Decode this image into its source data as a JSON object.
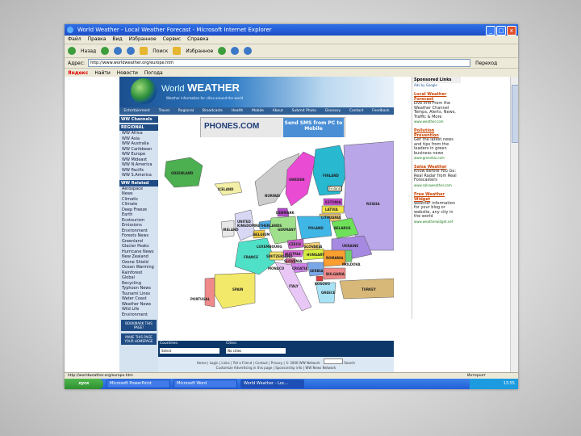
{
  "window": {
    "title": "World Weather - Local Weather Forecast - Microsoft Internet Explorer",
    "controls": [
      "_",
      "□",
      "x"
    ]
  },
  "menu": [
    "Файл",
    "Правка",
    "Вид",
    "Избранное",
    "Сервис",
    "Справка"
  ],
  "toolbar": {
    "back": "Назад",
    "search": "Поиск",
    "favorites": "Избранное"
  },
  "address": {
    "label": "Адрес:",
    "url": "http://www.worldweather.org/europe.htm",
    "go": "Переход"
  },
  "yandex": {
    "logo": "Яндекс",
    "find": "Найти",
    "news": "Новости",
    "weather": "Погода"
  },
  "site": {
    "brand_prefix": "World",
    "brand_main": "WEATHER",
    "slogan": "Weather information for cities around the world",
    "nav": [
      "Entertainment",
      "Travel",
      "Regional",
      "Broadcasts",
      "Health",
      "Mobile",
      "About",
      "Submit Photo",
      "Glossary",
      "Contact",
      "Feedback"
    ],
    "sidebar": {
      "channels": "WW Channels",
      "regional_head": "REGIONAL",
      "regional": [
        "WW Africa",
        "WW Asia",
        "WW Australia",
        "WW Caribbean",
        "WW Europe",
        "WW Mideast",
        "WW N.America",
        "WW Pacific",
        "WW S.America"
      ],
      "related_head": "WW Related",
      "related": [
        "Aerospace",
        "News",
        "Climatic",
        "Climate",
        "Deep Freeze",
        "Earth",
        "Ecotourism",
        "Emissions",
        "Environment",
        "Forests News",
        "Greenland",
        "Glacier Peaks",
        "Hurricane News",
        "New Zealand",
        "Ozone Shield",
        "Ocean Warming",
        "Rainforest",
        "Global",
        "Recycling",
        "Typhoon News",
        "Tsunami Lines",
        "Water Coast",
        "Weather News",
        "Wild Life",
        "Environment"
      ],
      "bookmark": "BOOKMARK THIS PAGE!",
      "homepage": "MAKE THIS PAGE YOUR HOMEPAGE"
    },
    "ad": {
      "phones": "PHONES.COM",
      "sms": "Send SMS from PC to Mobile"
    },
    "map_labels": {
      "greenland": "GREENLAND",
      "iceland": "ICELAND",
      "sweden": "SWEDEN",
      "finland": "FINLAND",
      "norway": "NORWAY",
      "russia": "RUSSIA",
      "estonia": "ESTONIA",
      "latvia": "LATVIA",
      "lithuania": "LITHUANIA",
      "denmark": "DENMARK",
      "uk": "UNITED KINGDOM",
      "ireland": "IRELAND",
      "netherlands": "NETHERLANDS",
      "belgium": "BELGIUM",
      "germany": "GERMANY",
      "poland": "POLAND",
      "belarus": "BELARUS",
      "ukraine": "UKRAINE",
      "france": "FRANCE",
      "luxembourg": "LUXEMBOURG",
      "czech": "CZECH",
      "slovakia": "SLOVAKIA",
      "austria": "AUSTRIA",
      "switzerland": "SWITZERLAND",
      "hungary": "HUNGARY",
      "romania": "ROMANIA",
      "moldova": "MOLDOVA",
      "italy": "ITALY",
      "spain": "SPAIN",
      "portugal": "PORTUGAL",
      "bulgaria": "BULGARIA",
      "greece": "GREECE",
      "slovenia": "SLOVENIA",
      "croatia": "CROATIA",
      "monaco": "MONACO",
      "turkey": "TURKEY",
      "kosovo": "KOSOVO",
      "serbia": "SERBIA",
      "tooltip": "Finland"
    },
    "countries_label": "Countries:",
    "countries_value": "Select",
    "cities_label": "Cities:",
    "cities_value": "No cities",
    "footer_line1": "Home | Login | Links | Tell a Friend | Contact | Privacy | © 2006 WW Network",
    "footer_search": "Search",
    "footer_line2": "Customize Advertising in this page | Sponsorship info | WW News Network"
  },
  "sponsored": {
    "title": "Sponsored Links",
    "google": "Ads by Google",
    "links": [
      {
        "title": "Local Weather Forecast",
        "desc": "Live Info From the Weather Channel Temps, Alerts, News, Traffic & More",
        "url": "www.weather.com"
      },
      {
        "title": "Pollution Prevention",
        "desc": "Get the latest news and tips from the leaders in green business news",
        "url": "www.greenbiz.com"
      },
      {
        "title": "Salsa Weather",
        "desc": "Know Before You Go: Real Radar from Real Forecasters",
        "url": "www.salsaweather.com"
      },
      {
        "title": "Free Weather Widget",
        "desc": "weather information for your blog or website, any city in the world",
        "url": "www.weatherwidget.net"
      }
    ]
  },
  "status": {
    "text": "http://worldweather.org/europe.htm",
    "zone": "Интернет"
  },
  "taskbar": {
    "start": "пуск",
    "tasks": [
      "Microsoft PowerPoint",
      "Microsoft Word",
      "World Weather - Loc..."
    ],
    "time": "13:55"
  },
  "colors": {
    "titlebar": "#245edb",
    "banner": "#1a4f8f",
    "sidebar": "#d5e2f0",
    "link": "#cc4400"
  }
}
